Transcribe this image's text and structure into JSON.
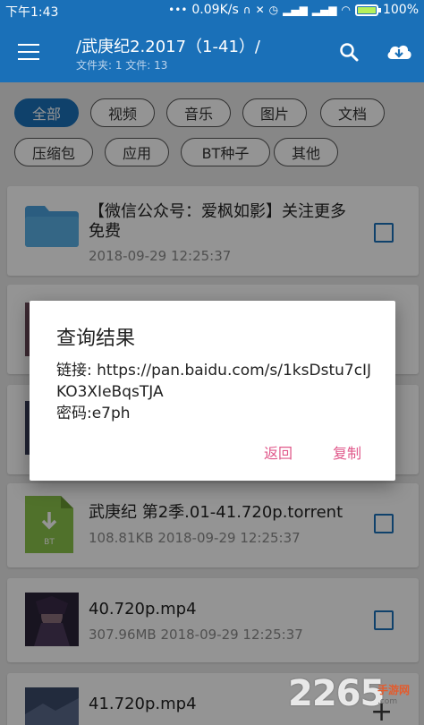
{
  "status_bar": {
    "time": "下午1:43",
    "net_speed": "0.09K/s",
    "battery": "100%",
    "battery_level": 1.0
  },
  "app_bar": {
    "title": "/武庚纪2.2017（1-41）/",
    "subtitle": "文件夹: 1 文件: 13",
    "icons": [
      "menu-icon",
      "search-icon",
      "cloud-download-icon"
    ]
  },
  "filters": [
    "全部",
    "视频",
    "音乐",
    "图片",
    "文档",
    "压缩包",
    "应用",
    "BT种子",
    "其他"
  ],
  "active_filter": "全部",
  "files": [
    {
      "name_line1": "【微信公众号：爱枫如影】关注更多",
      "name_line2": "免费",
      "meta": "2018-09-29 12:25:37",
      "type": "folder"
    },
    {
      "name": "武庚纪 第2季.01-41.720p.torrent",
      "meta": "108.81KB 2018-09-29 12:25:37",
      "type": "torrent",
      "badge": "BT"
    },
    {
      "name": "40.720p.mp4",
      "meta": "307.96MB 2018-09-29 12:25:37",
      "type": "video"
    },
    {
      "name": "41.720p.mp4",
      "type": "video"
    }
  ],
  "dialog": {
    "title": "查询结果",
    "link_label": "链接: https://pan.baidu.com/s/1ksDstu7cIJKO3XIeBqsTJA",
    "password_label": "密码:e7ph",
    "back_label": "返回",
    "copy_label": "复制"
  },
  "watermark": {
    "number": "2265",
    "cn": "手游网",
    "url": ".com"
  },
  "colors": {
    "primary": "#1a70b8",
    "accent": "#e0588a",
    "folder": "#4aa0dc",
    "torrent": "#8bc34a"
  }
}
